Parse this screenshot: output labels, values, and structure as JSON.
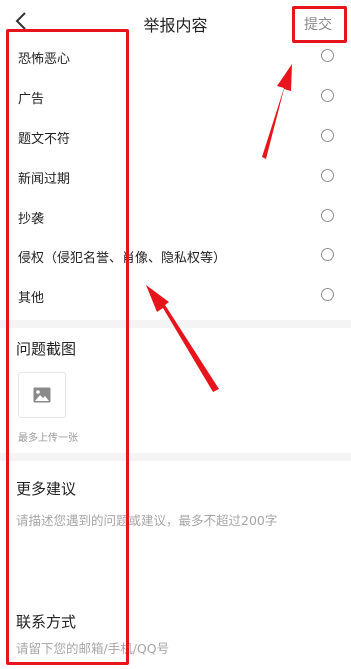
{
  "header": {
    "back_icon": "chevron-left-icon",
    "title": "举报内容",
    "submit_label": "提交"
  },
  "reasons": [
    {
      "label": "恐怖恶心",
      "selected": false
    },
    {
      "label": "广告",
      "selected": false
    },
    {
      "label": "题文不符",
      "selected": false
    },
    {
      "label": "新闻过期",
      "selected": false
    },
    {
      "label": "抄袭",
      "selected": false
    },
    {
      "label": "侵权（侵犯名誉、肖像、隐私权等）",
      "selected": false
    },
    {
      "label": "其他",
      "selected": false
    }
  ],
  "screenshot_section": {
    "title": "问题截图",
    "upload_icon": "image-icon",
    "hint": "最多上传一张"
  },
  "suggestion_section": {
    "title": "更多建议",
    "placeholder": "请描述您遇到的问题或建议，最多不超过200字"
  },
  "contact_section": {
    "title": "联系方式",
    "placeholder": "请留下您的邮箱/手机/QQ号"
  },
  "annotation_color": "#e8141b"
}
